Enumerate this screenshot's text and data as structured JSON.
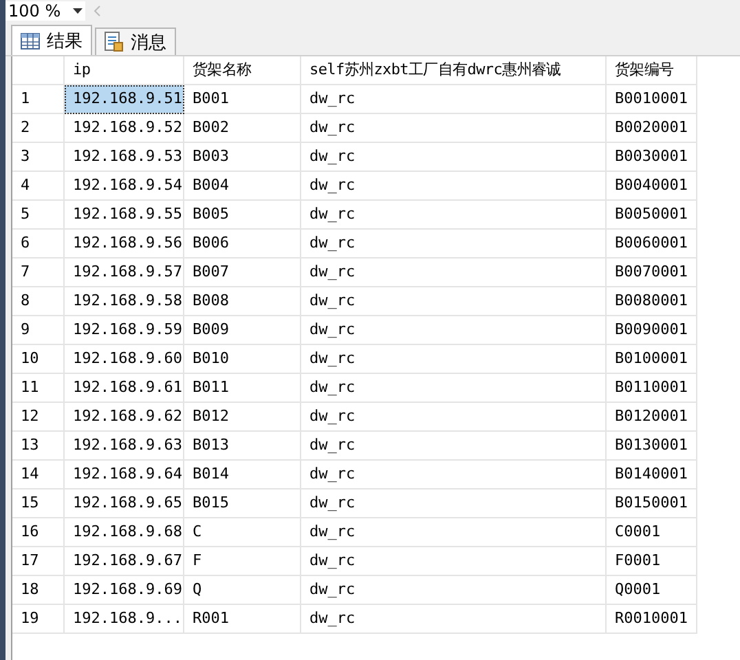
{
  "zoom": {
    "value": "100 %"
  },
  "tabs": [
    {
      "label": "结果",
      "kind": "grid",
      "selected": true
    },
    {
      "label": "消息",
      "kind": "messages",
      "selected": false
    }
  ],
  "table": {
    "columns": [
      "ip",
      "货架名称",
      "self苏州zxbt工厂自有dwrc惠州睿诚",
      "货架编号"
    ],
    "rows": [
      {
        "num": "1",
        "cells": [
          "192.168.9.51",
          "B001",
          "dw_rc",
          "B0010001"
        ],
        "selected": true
      },
      {
        "num": "2",
        "cells": [
          "192.168.9.52",
          "B002",
          "dw_rc",
          "B0020001"
        ],
        "selected": false
      },
      {
        "num": "3",
        "cells": [
          "192.168.9.53",
          "B003",
          "dw_rc",
          "B0030001"
        ],
        "selected": false
      },
      {
        "num": "4",
        "cells": [
          "192.168.9.54",
          "B004",
          "dw_rc",
          "B0040001"
        ],
        "selected": false
      },
      {
        "num": "5",
        "cells": [
          "192.168.9.55",
          "B005",
          "dw_rc",
          "B0050001"
        ],
        "selected": false
      },
      {
        "num": "6",
        "cells": [
          "192.168.9.56",
          "B006",
          "dw_rc",
          "B0060001"
        ],
        "selected": false
      },
      {
        "num": "7",
        "cells": [
          "192.168.9.57",
          "B007",
          "dw_rc",
          "B0070001"
        ],
        "selected": false
      },
      {
        "num": "8",
        "cells": [
          "192.168.9.58",
          "B008",
          "dw_rc",
          "B0080001"
        ],
        "selected": false
      },
      {
        "num": "9",
        "cells": [
          "192.168.9.59",
          "B009",
          "dw_rc",
          "B0090001"
        ],
        "selected": false
      },
      {
        "num": "10",
        "cells": [
          "192.168.9.60",
          "B010",
          "dw_rc",
          "B0100001"
        ],
        "selected": false
      },
      {
        "num": "11",
        "cells": [
          "192.168.9.61",
          "B011",
          "dw_rc",
          "B0110001"
        ],
        "selected": false
      },
      {
        "num": "12",
        "cells": [
          "192.168.9.62",
          "B012",
          "dw_rc",
          "B0120001"
        ],
        "selected": false
      },
      {
        "num": "13",
        "cells": [
          "192.168.9.63",
          "B013",
          "dw_rc",
          "B0130001"
        ],
        "selected": false
      },
      {
        "num": "14",
        "cells": [
          "192.168.9.64",
          "B014",
          "dw_rc",
          "B0140001"
        ],
        "selected": false
      },
      {
        "num": "15",
        "cells": [
          "192.168.9.65",
          "B015",
          "dw_rc",
          "B0150001"
        ],
        "selected": false
      },
      {
        "num": "16",
        "cells": [
          "192.168.9.68",
          "C",
          "dw_rc",
          "C0001"
        ],
        "selected": false
      },
      {
        "num": "17",
        "cells": [
          "192.168.9.67",
          "F",
          "dw_rc",
          "F0001"
        ],
        "selected": false
      },
      {
        "num": "18",
        "cells": [
          "192.168.9.69",
          "Q",
          "dw_rc",
          "Q0001"
        ],
        "selected": false
      },
      {
        "num": "19",
        "cells": [
          "192.168.9...",
          "R001",
          "dw_rc",
          "R0010001"
        ],
        "selected": false
      }
    ]
  }
}
